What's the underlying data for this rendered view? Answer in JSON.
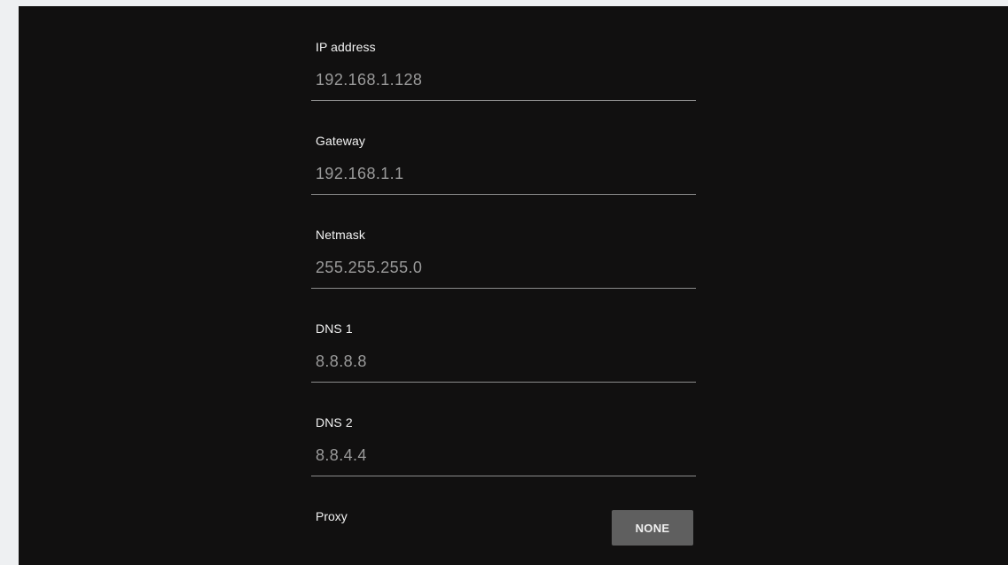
{
  "fields": [
    {
      "label": "IP address",
      "value": "192.168.1.128"
    },
    {
      "label": "Gateway",
      "value": "192.168.1.1"
    },
    {
      "label": "Netmask",
      "value": "255.255.255.0"
    },
    {
      "label": "DNS 1",
      "value": "8.8.8.8"
    },
    {
      "label": "DNS 2",
      "value": "8.8.4.4"
    }
  ],
  "proxy": {
    "label": "Proxy",
    "button_label": "NONE"
  },
  "colors": {
    "screen_background": "#111010",
    "page_background": "#eef0f2",
    "label_text": "#f2f2f2",
    "value_text": "#9a9a9a",
    "underline": "#8c8c8c",
    "button_background": "#5f5f5f"
  }
}
